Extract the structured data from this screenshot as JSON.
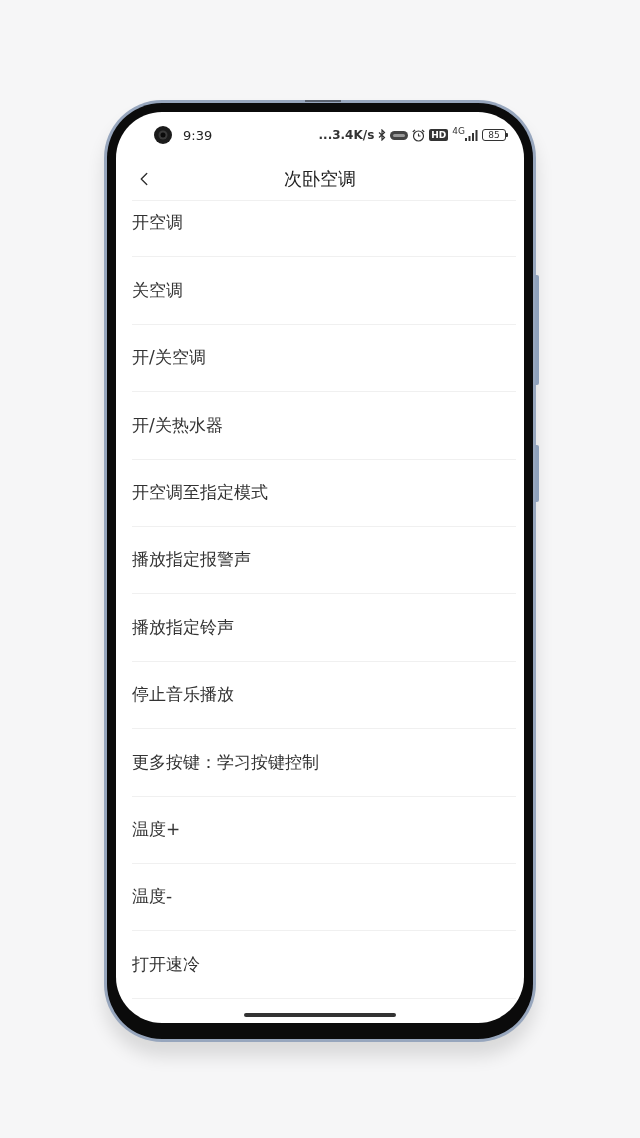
{
  "status_bar": {
    "time": "9:39",
    "network_speed": "...3.4K/s",
    "hd_badge": "HD",
    "network_type": "4G",
    "battery": "85"
  },
  "header": {
    "title": "次卧空调"
  },
  "items": [
    "开空调",
    "关空调",
    "开/关空调",
    "开/关热水器",
    "开空调至指定模式",
    "播放指定报警声",
    "播放指定铃声",
    "停止音乐播放",
    "更多按键：学习按键控制",
    "温度+",
    "温度-",
    "打开速冷"
  ]
}
